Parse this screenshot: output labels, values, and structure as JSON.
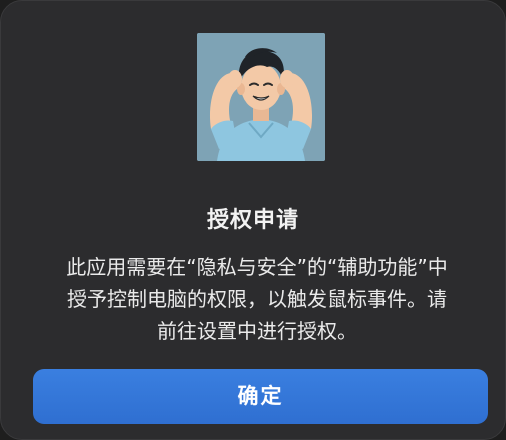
{
  "dialog": {
    "title": "授权申请",
    "message": "此应用需要在“隐私与安全”的“辅助功能”中\n授予控制电脑的权限，以触发鼠标事件。请\n前往设置中进行授权。",
    "confirm_label": "确定",
    "icon": "user-avatar-illustration"
  },
  "colors": {
    "dialog_background": "#2c2c2e",
    "accent": "#3478f6",
    "icon_background": "#7ea3b5"
  }
}
